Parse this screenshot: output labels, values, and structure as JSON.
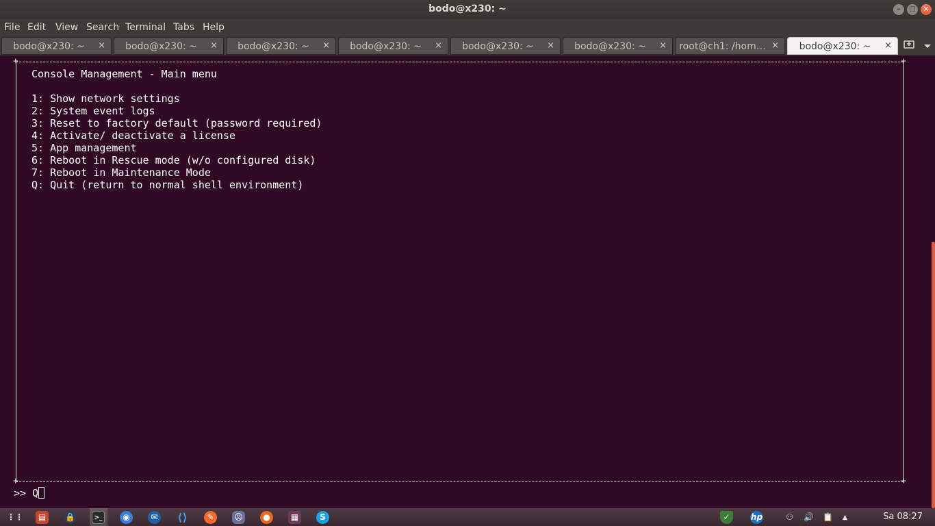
{
  "window": {
    "title": "bodo@x230: ~"
  },
  "window_buttons": {
    "minimize": "–",
    "maximize": "□",
    "close": "×"
  },
  "menu": [
    "File",
    "Edit",
    "View",
    "Search",
    "Terminal",
    "Tabs",
    "Help"
  ],
  "tabs": [
    {
      "label": "bodo@x230: ~"
    },
    {
      "label": "bodo@x230: ~"
    },
    {
      "label": "bodo@x230: ~"
    },
    {
      "label": "bodo@x230: ~"
    },
    {
      "label": "bodo@x230: ~"
    },
    {
      "label": "bodo@x230: ~"
    },
    {
      "label": "root@ch1: /hom…"
    },
    {
      "label": "bodo@x230: ~"
    }
  ],
  "tab_close_glyph": "×",
  "terminal": {
    "menu_title": "Console Management - Main menu",
    "items": [
      "1: Show network settings",
      "2: System event logs",
      "3: Reset to factory default (password required)",
      "4: Activate/ deactivate a license",
      "5: App management",
      "6: Reboot in Rescue mode (w/o configured disk)",
      "7: Reboot in Maintenance Mode",
      "Q: Quit (return to normal shell environment)"
    ],
    "prompt": ">> ",
    "input": "Q"
  },
  "taskbar": {
    "apps": [
      "app-grid-icon",
      "files-icon",
      "keepassxc-icon",
      "terminal-icon",
      "chromium-icon",
      "thunderbird-icon",
      "vscode-icon",
      "brave-icon",
      "discord-icon",
      "firefox-icon",
      "video-editor-icon",
      "skype-icon"
    ],
    "clock": "Sa 08:27"
  },
  "colors": {
    "terminal_bg": "#300a24",
    "accent": "#e15a36"
  }
}
